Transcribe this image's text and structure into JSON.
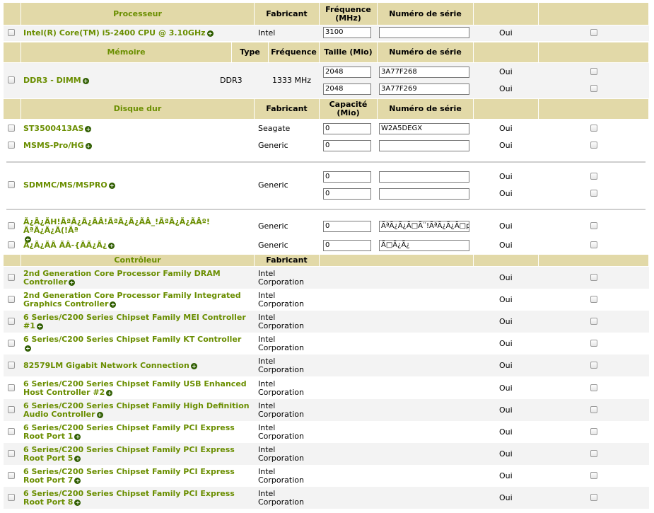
{
  "plus_symbol": "+",
  "oui": "Oui",
  "processor": {
    "headers": {
      "component": "Processeur",
      "maker": "Fabricant",
      "freq": "Fréquence (MHz)",
      "serial": "Numéro de série"
    },
    "rows": [
      {
        "name": "Intel(R) Core(TM) i5-2400 CPU @ 3.10GHz",
        "maker": "Intel",
        "freq": "3100",
        "serial": ""
      }
    ]
  },
  "memory": {
    "headers": {
      "component": "Mémoire",
      "type": "Type",
      "freq": "Fréquence",
      "size": "Taille (Mio)",
      "serial": "Numéro de série"
    },
    "rows": [
      {
        "name": "DDR3 - DIMM",
        "type": "DDR3",
        "freq": "1333 MHz",
        "sizes": [
          "2048",
          "2048"
        ],
        "serials": [
          "3A77F268",
          "3A77F269"
        ]
      }
    ]
  },
  "disks": {
    "headers": {
      "component": "Disque dur",
      "maker": "Fabricant",
      "capacity": "Capacité (Mio)",
      "serial": "Numéro de série"
    },
    "rows": [
      {
        "name": "ST3500413AS",
        "maker": "Seagate",
        "capacity": "0",
        "serial": "W2A5DEGX"
      },
      {
        "name": "MSMS-Pro/HG",
        "maker": "Generic",
        "capacity": "0",
        "serial": ""
      },
      {
        "name": "SDMMC/MS/MSPRO",
        "maker": "Generic",
        "capacities": [
          "0",
          "0"
        ],
        "serials": [
          "",
          ""
        ]
      },
      {
        "name": "Ã¿Ã¿ÃH!ÃªÃ¿Ã¿ÃÂ!ÃªÃ¿Ã¿ÃÂ_!ÃªÃ¿Ã¿ÃÂº!ÃªÃ¿Ã¿Ã(!Ãª",
        "maker": "Generic",
        "capacity": "0",
        "serial": "ÃªÃ¿Ã¿Ã□Ã¨!ÃªÃ¿Ã¿Ã□p!"
      },
      {
        "name": "Ã¿Ã¿ÃÂ ÃÂ-{ÃÃ¿Ã¿",
        "maker": "Generic",
        "capacity": "0",
        "serial": "Ã□Ã¿Ã¿"
      }
    ]
  },
  "controllers": {
    "headers": {
      "component": "Contrôleur",
      "maker": "Fabricant"
    },
    "rows": [
      {
        "name1": "2nd Generation Core Processor Family DRAM",
        "name2": "Controller",
        "maker1": "Intel",
        "maker2": "Corporation"
      },
      {
        "name1": "2nd Generation Core Processor Family Integrated",
        "name2": "Graphics Controller",
        "maker1": "Intel",
        "maker2": "Corporation"
      },
      {
        "name1": "6 Series/C200 Series Chipset Family MEI Controller",
        "name2": "#1",
        "maker1": "Intel",
        "maker2": "Corporation"
      },
      {
        "name1": "6 Series/C200 Series Chipset Family KT Controller",
        "name2": "",
        "maker1": "Intel",
        "maker2": "Corporation"
      },
      {
        "name1": "82579LM Gigabit Network Connection",
        "name2": "",
        "maker1": "Intel",
        "maker2": "Corporation"
      },
      {
        "name1": "6 Series/C200 Series Chipset Family USB Enhanced",
        "name2": "Host Controller #2",
        "maker1": "Intel",
        "maker2": "Corporation"
      },
      {
        "name1": "6 Series/C200 Series Chipset Family High Definition",
        "name2": "Audio Controller",
        "maker1": "Intel",
        "maker2": "Corporation"
      },
      {
        "name1": "6 Series/C200 Series Chipset Family PCI Express",
        "name2": "Root Port 1",
        "maker1": "Intel",
        "maker2": "Corporation"
      },
      {
        "name1": "6 Series/C200 Series Chipset Family PCI Express",
        "name2": "Root Port 5",
        "maker1": "Intel",
        "maker2": "Corporation"
      },
      {
        "name1": "6 Series/C200 Series Chipset Family PCI Express",
        "name2": "Root Port 7",
        "maker1": "Intel",
        "maker2": "Corporation"
      },
      {
        "name1": "6 Series/C200 Series Chipset Family PCI Express",
        "name2": "Root Port 8",
        "maker1": "Intel",
        "maker2": "Corporation"
      }
    ]
  }
}
